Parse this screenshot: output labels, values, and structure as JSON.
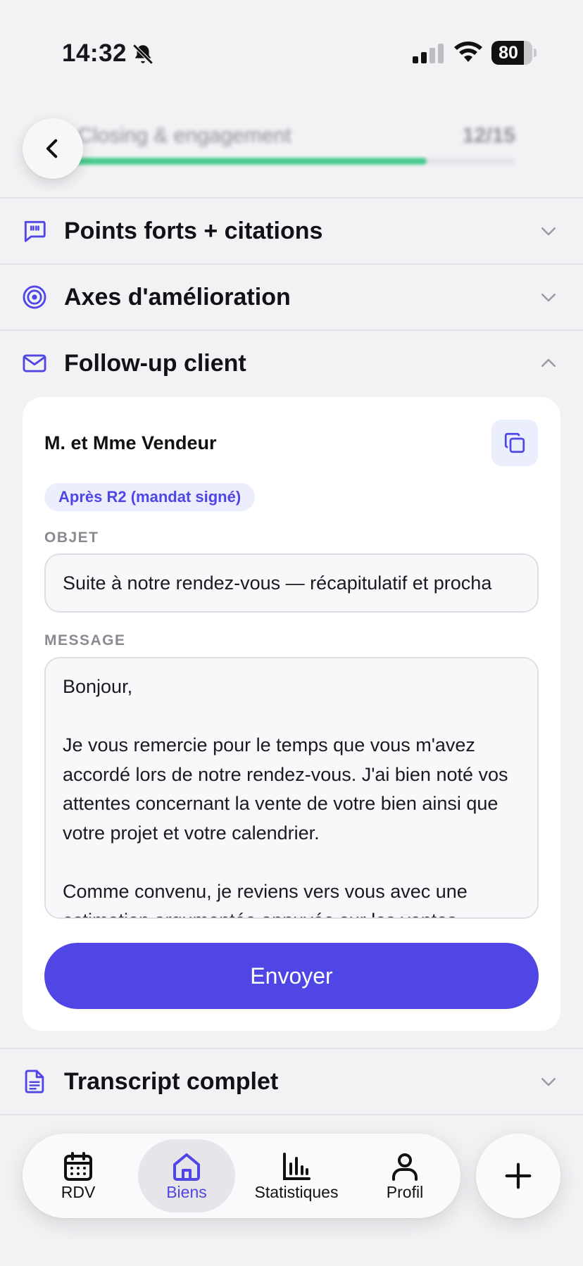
{
  "status_bar": {
    "time": "14:32",
    "battery_level": "80",
    "battery_fraction": 0.8,
    "icons": [
      "bell-slash-icon",
      "signal-icon",
      "wifi-icon",
      "battery-icon"
    ]
  },
  "progress": {
    "label": "Closing & engagement",
    "count": "12/15",
    "fraction": 0.8,
    "accent": "#4ccb8e"
  },
  "sections": [
    {
      "title": "Points forts + citations",
      "icon": "quote-bubble-icon",
      "expanded": false
    },
    {
      "title": "Axes d'amélioration",
      "icon": "target-icon",
      "expanded": false
    },
    {
      "title": "Follow-up client",
      "icon": "mail-icon",
      "expanded": true
    },
    {
      "title": "Transcript complet",
      "icon": "document-icon",
      "expanded": false
    }
  ],
  "followup": {
    "recipient": "M. et Mme Vendeur",
    "tag": "Après R2 (mandat signé)",
    "subject_label": "OBJET",
    "subject_value": "Suite à notre rendez-vous — récapitulatif et procha",
    "message_label": "MESSAGE",
    "message_lines": [
      "Bonjour,",
      "",
      "Je vous remercie pour le temps que vous m'avez accordé lors de notre rendez-vous. J'ai bien noté vos attentes concernant la vente de votre bien ainsi que votre projet et votre calendrier.",
      "",
      "Comme convenu, je reviens vers vous avec une estimation argumentée appuyée sur les ventes"
    ],
    "send_label": "Envoyer"
  },
  "tabbar": {
    "tabs": [
      {
        "label": "RDV",
        "icon": "calendar-icon",
        "active": false
      },
      {
        "label": "Biens",
        "icon": "home-icon",
        "active": true
      },
      {
        "label": "Statistiques",
        "icon": "bar-chart-icon",
        "active": false
      },
      {
        "label": "Profil",
        "icon": "user-icon",
        "active": false
      }
    ],
    "fab_icon": "plus-icon"
  },
  "colors": {
    "accent": "#4f46e5",
    "accent_soft": "#eceefd",
    "progress": "#4ccb8e",
    "background": "#f2f2f5"
  }
}
